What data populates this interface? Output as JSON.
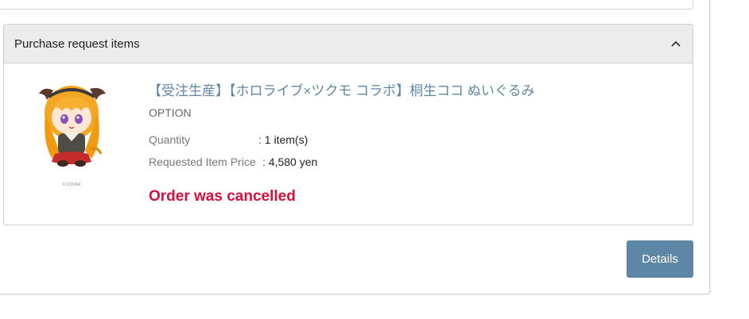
{
  "panel": {
    "title": "Purchase request items",
    "collapse_icon": "chevron-up-icon"
  },
  "item": {
    "image_icon": "plush-doll-image",
    "image_caption": "© COVER",
    "title": "【受注生産】【ホロライブ×ツクモ コラボ】桐生ココ ぬいぐるみ",
    "option": "OPTION",
    "quantity_label": "Quantity",
    "quantity_value": "1 item(s)",
    "price_label": "Requested Item Price",
    "price_value": "4,580 yen",
    "separator": ":",
    "status": "Order was cancelled"
  },
  "actions": {
    "details_label": "Details"
  },
  "colors": {
    "accent": "#5e87a6",
    "status_cancelled": "#d4103d",
    "header_bg": "#ececec"
  }
}
